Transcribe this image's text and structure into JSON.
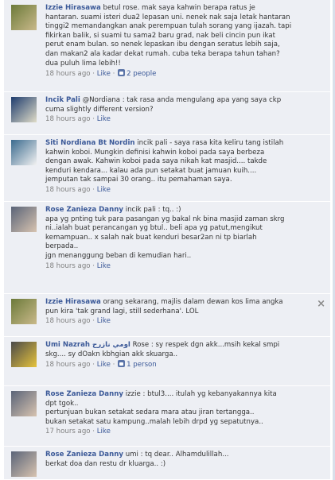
{
  "comments": [
    {
      "author": "Izzie Hirasawa",
      "lines": [
        "betul rose. mak saya kahwin berapa ratus je",
        "hantaran. suami isteri dua2 lepasan uni. nenek nak saja letak hantaran",
        "tinggi2 memandangkan anak perempuan tulah sorang yang ijazah.  tapi",
        "fikirkan balik, si suami tu sama2 baru grad, nak beli cincin pun ikat",
        "perut enam bulan. so nenek lepaskan ibu dengan seratus lebih saja,",
        "dan makan2 ala kadar dekat rumah. cuba teka berapa tahun tahan?",
        "dua puluh lima lebih!!"
      ],
      "time": "18 hours ago",
      "like_label": "Like",
      "people_label": "2 people"
    },
    {
      "author": "Incik Pali",
      "lines": [
        "@Nordiana : tak rasa anda mengulang apa yang saya ckp",
        "cuma slightly different version?"
      ],
      "time": "18 hours ago",
      "like_label": "Like"
    },
    {
      "author": "Siti Nordiana Bt Nordin",
      "lines": [
        "incik pali - saya rasa kita keliru tang istilah",
        "kahwin koboi. Mungkin definisi kahwin koboi pada saya berbeza",
        "dengan awak. Kahwin koboi pada saya nikah kat masjid.... takde",
        "kenduri kendara... kalau ada pun setakat buat jamuan kuih....",
        "jemputan tak sampai 30 orang.. itu pemahaman saya."
      ],
      "time": "18 hours ago",
      "like_label": "Like"
    },
    {
      "author": "Rose Zanieza Danny",
      "lines": [
        "incik pali : tq.. :)",
        "apa yg pnting tuk para pasangan yg bakal nk bina masjid zaman skrg",
        "ni..ialah buat perancangan yg btul.. beli apa yg patut,mengikut",
        "kemampuan.. x salah nak buat kenduri besar2an ni tp biarlah",
        "berpada..",
        "jgn menanggung beban di kemudian hari.."
      ],
      "time": "18 hours ago",
      "like_label": "Like"
    },
    {
      "author": "Izzie Hirasawa",
      "lines": [
        "orang sekarang, majlis dalam dewan kos lima angka",
        "pun kira 'tak grand lagi, still sederhana'. LOL"
      ],
      "time": "18 hours ago",
      "like_label": "Like",
      "close_label": "×"
    },
    {
      "author": "Umi Nazrah اومي نازرح",
      "lines": [
        "Rose : sy respek dgn akk...msih kekal smpi",
        "skg.... sy dOakn kbhgian akk skuarga.."
      ],
      "time": "18 hours ago",
      "like_label": "Like",
      "people_label": "1 person"
    },
    {
      "author": "Rose Zanieza Danny",
      "lines": [
        "izzie : btul3.... itulah yg kebanyakannya kita",
        "dpt tgok..",
        "pertunjuan bukan setakat sedara mara atau jiran tertangga..",
        "bukan setakat satu kampung..malah lebih drpd yg sepatutnya.."
      ],
      "time": "17 hours ago",
      "like_label": "Like"
    },
    {
      "author": "Rose Zanieza Danny",
      "lines": [
        "umi : tq dear.. Alhamdulillah...",
        "berkat doa dan restu dr kluarga.. :)"
      ],
      "time": "",
      "like_label": ""
    }
  ],
  "colors": {
    "comment_bg": "#edeff4",
    "author_link": "#3b5998",
    "meta_text": "#808080",
    "body_text": "#333333"
  },
  "icons": {
    "like": "thumbs-up-icon",
    "close": "close-icon"
  }
}
